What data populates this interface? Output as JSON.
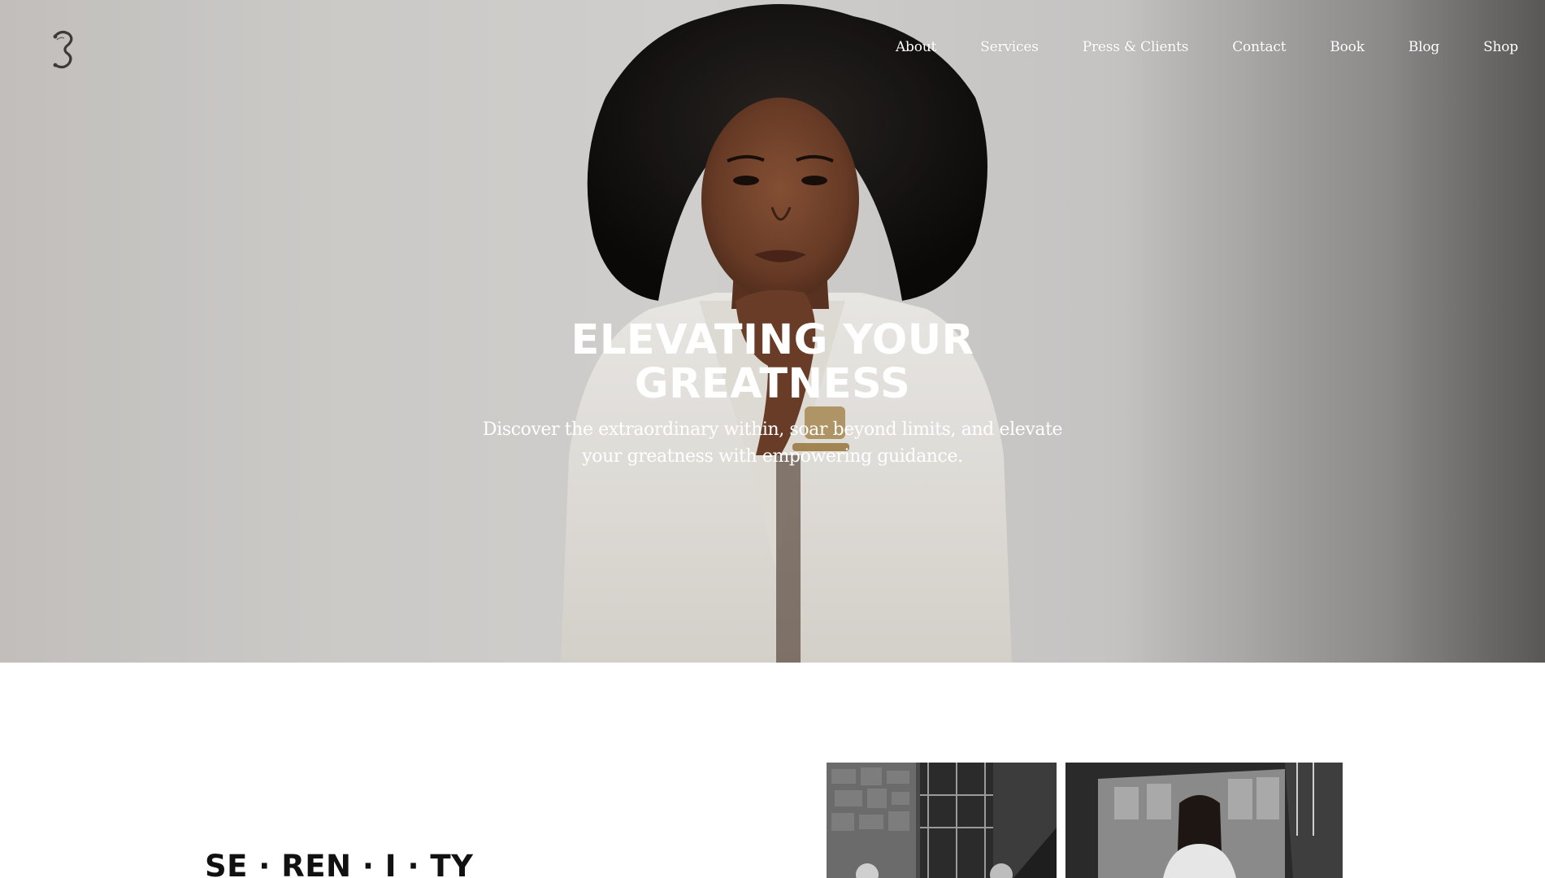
{
  "brand": {
    "logo_icon": "ornate-letter-s-logo"
  },
  "nav": {
    "items": [
      {
        "label": "About"
      },
      {
        "label": "Services"
      },
      {
        "label": "Press & Clients"
      },
      {
        "label": "Contact"
      },
      {
        "label": "Book"
      },
      {
        "label": "Blog"
      },
      {
        "label": "Shop"
      }
    ]
  },
  "hero": {
    "title": "ELEVATING YOUR GREATNESS",
    "subtitle": "Discover the extraordinary within, soar beyond limits, and elevate your greatness with empowering guidance.",
    "image": "portrait-of-woman-in-white-blazer"
  },
  "section": {
    "heading": "SE · REN · I · TY",
    "images": [
      "black-and-white-interior-photo",
      "black-and-white-interview-photo"
    ]
  },
  "colors": {
    "hero_text": "#ffffff",
    "heading_text": "#111111",
    "page_background": "#ffffff"
  }
}
